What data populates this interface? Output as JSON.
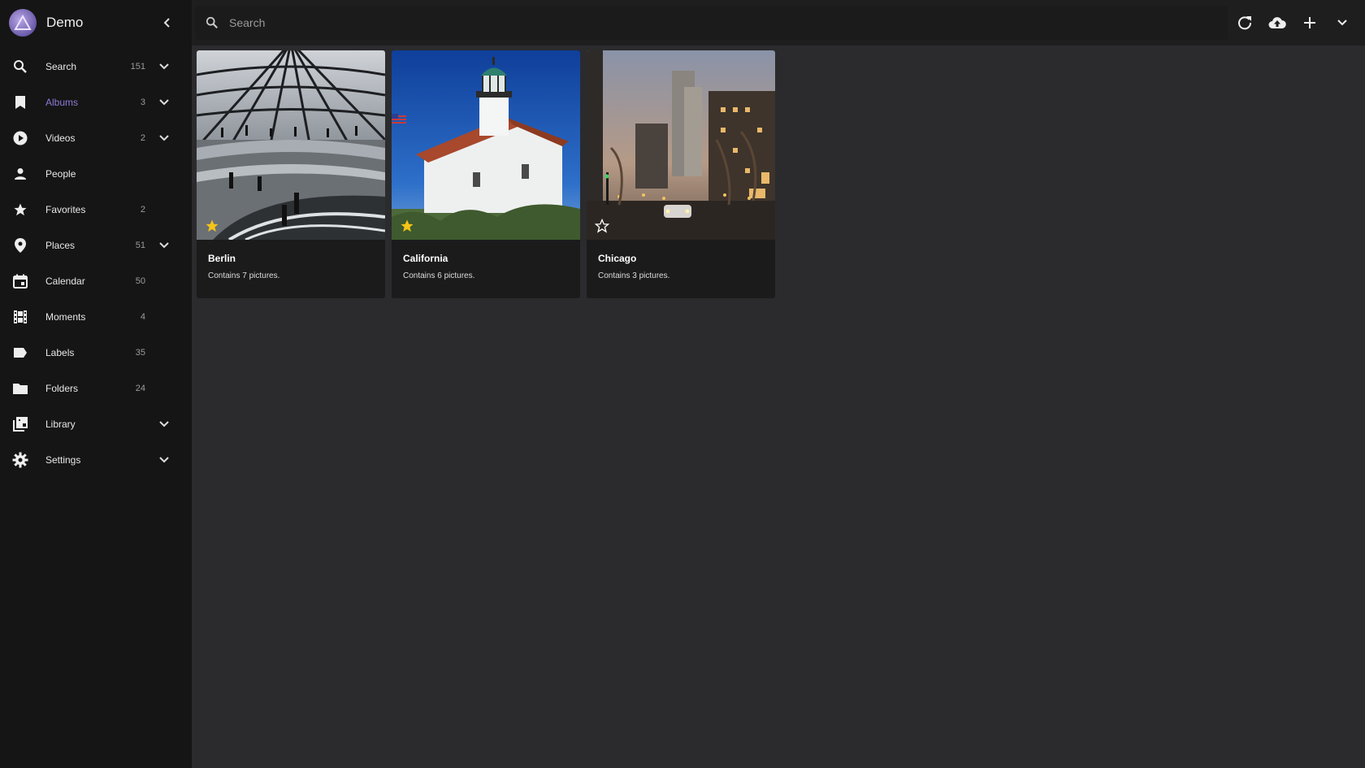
{
  "app": {
    "title": "Demo"
  },
  "search": {
    "placeholder": "Search"
  },
  "sidebar": {
    "items": [
      {
        "label": "Search",
        "count": "151",
        "icon": "search-icon",
        "expandable": true
      },
      {
        "label": "Albums",
        "count": "3",
        "icon": "bookmark-icon",
        "expandable": true,
        "active": true
      },
      {
        "label": "Videos",
        "count": "2",
        "icon": "play-circle-icon",
        "expandable": true
      },
      {
        "label": "People",
        "count": "",
        "icon": "person-icon",
        "expandable": false
      },
      {
        "label": "Favorites",
        "count": "2",
        "icon": "star-icon",
        "expandable": false
      },
      {
        "label": "Places",
        "count": "51",
        "icon": "map-pin-icon",
        "expandable": true
      },
      {
        "label": "Calendar",
        "count": "50",
        "icon": "calendar-icon",
        "expandable": false
      },
      {
        "label": "Moments",
        "count": "4",
        "icon": "film-icon",
        "expandable": false
      },
      {
        "label": "Labels",
        "count": "35",
        "icon": "label-icon",
        "expandable": false
      },
      {
        "label": "Folders",
        "count": "24",
        "icon": "folder-icon",
        "expandable": false
      },
      {
        "label": "Library",
        "count": "",
        "icon": "library-icon",
        "expandable": true
      },
      {
        "label": "Settings",
        "count": "",
        "icon": "gear-icon",
        "expandable": true
      }
    ]
  },
  "toolbar": {
    "icons": [
      "refresh-icon",
      "cloud-upload-icon",
      "plus-icon",
      "chevron-down-icon"
    ]
  },
  "albums": [
    {
      "title": "Berlin",
      "description": "Contains 7 pictures.",
      "favorite": true
    },
    {
      "title": "California",
      "description": "Contains 6 pictures.",
      "favorite": true
    },
    {
      "title": "Chicago",
      "description": "Contains 3 pictures.",
      "favorite": false
    }
  ],
  "colors": {
    "accent": "#8e79d6",
    "sidebar_bg": "#151515",
    "content_bg": "#2b2b2d",
    "star": "#f5c518"
  }
}
